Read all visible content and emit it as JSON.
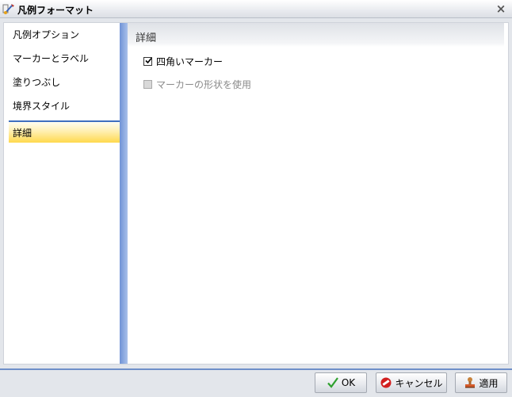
{
  "window": {
    "title": "凡例フォーマット",
    "close_glyph": "×"
  },
  "nav": {
    "items": [
      {
        "label": "凡例オプション",
        "selected": false
      },
      {
        "label": "マーカーとラベル",
        "selected": false
      },
      {
        "label": "塗りつぶし",
        "selected": false
      },
      {
        "label": "境界スタイル",
        "selected": false
      },
      {
        "label": "詳細",
        "selected": true
      }
    ]
  },
  "content": {
    "title": "詳細",
    "options": [
      {
        "label": "四角いマーカー",
        "checked": true,
        "enabled": true
      },
      {
        "label": "マーカーの形状を使用",
        "checked": false,
        "enabled": false
      }
    ]
  },
  "footer": {
    "ok_label": "OK",
    "cancel_label": "キャンセル",
    "apply_label": "適用"
  },
  "colors": {
    "accent": "#4a78c8",
    "selection": "#ffd94d",
    "ok_icon": "#2fa12f",
    "cancel_icon": "#d21f1f"
  },
  "icons": {
    "title": "legend-format-icon",
    "ok": "checkmark-icon",
    "cancel": "no-entry-icon",
    "apply": "stamp-icon"
  }
}
